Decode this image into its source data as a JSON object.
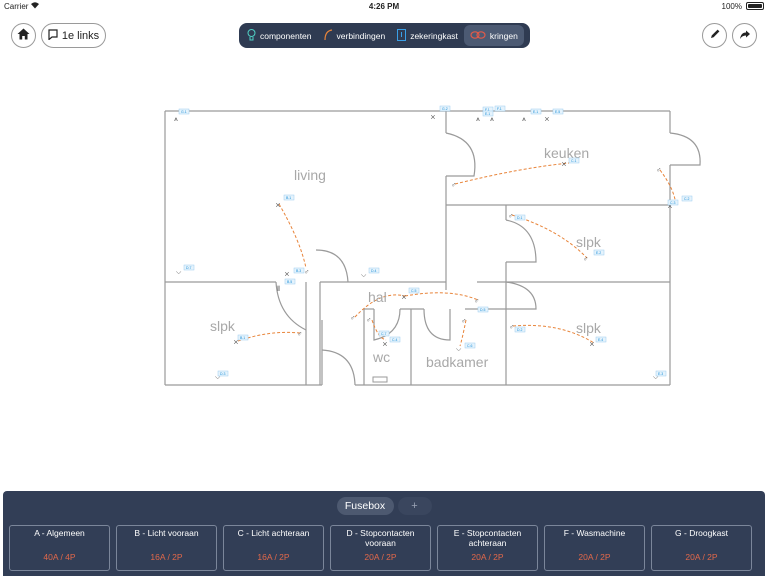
{
  "status_bar": {
    "carrier": "Carrier",
    "time": "4:26 PM",
    "battery": "100%"
  },
  "toolbar": {
    "floor_label": "1e links",
    "tabs": [
      {
        "label": "componenten",
        "icon": "bulb-icon",
        "active": false
      },
      {
        "label": "verbindingen",
        "icon": "connection-icon",
        "active": false
      },
      {
        "label": "zekeringkast",
        "icon": "fusebox-icon",
        "active": false
      },
      {
        "label": "kringen",
        "icon": "circuit-icon",
        "active": true
      }
    ]
  },
  "floorplan": {
    "rooms": [
      "living",
      "keuken",
      "slpk",
      "slpk",
      "slpk",
      "hal",
      "wc",
      "badkamer"
    ],
    "tags": [
      "G.1",
      "G.2",
      "F.1",
      "F.1",
      "E.1",
      "E.5",
      "C.1",
      "C.2",
      "D.7",
      "B.1",
      "B.1",
      "B.3",
      "B.5",
      "D.4",
      "C.4",
      "C.6",
      "C.3",
      "D.1",
      "E.2",
      "D.2",
      "E.4",
      "D.3",
      "D.5",
      "C.5",
      "E.3",
      "E.1",
      "C.7"
    ]
  },
  "fusebox": {
    "tab_label": "Fusebox",
    "add_label": "+",
    "circuits": [
      {
        "name": "A - Algemeen",
        "spec": "40A / 4P"
      },
      {
        "name": "B - Licht vooraan",
        "spec": "16A / 2P"
      },
      {
        "name": "C - Licht achteraan",
        "spec": "16A / 2P"
      },
      {
        "name": "D - Stopcontacten vooraan",
        "spec": "20A / 2P"
      },
      {
        "name": "E - Stopcontacten achteraan",
        "spec": "20A / 2P"
      },
      {
        "name": "F - Wasmachine",
        "spec": "20A / 2P"
      },
      {
        "name": "G - Droogkast",
        "spec": "20A / 2P"
      }
    ]
  },
  "colors": {
    "panel": "#323e56",
    "segmented": "#2f3b52",
    "accent_orange": "#e8843a",
    "spec_red": "#e2684a",
    "tag_blue": "#1a8fd8",
    "walls": "#999999"
  }
}
